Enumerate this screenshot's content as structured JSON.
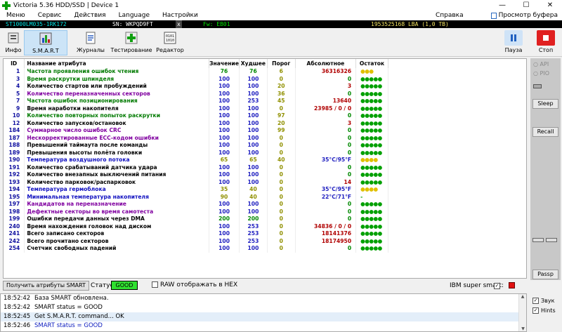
{
  "window": {
    "title": "Victoria 5.36 HDD/SSD | Device 1"
  },
  "menu": {
    "items": [
      "Меню",
      "Сервис",
      "Действия",
      "Language",
      "Настройки"
    ],
    "help": "Справка",
    "clipboard": "Просмотр буфера"
  },
  "info": {
    "model": "ST1000LM035-1RK172",
    "sn": "SN: WKPQD9FT",
    "close": "x",
    "fw": "Fw: EB01",
    "lba": "1953525168 LBA (1,0 TB)"
  },
  "toolbar": {
    "info": "Инфо",
    "smart": "S.M.A.R.T",
    "logs": "Журналы",
    "tests": "Тестирование",
    "editor": "Редактор",
    "pause": "Пауза",
    "stop": "Стоп"
  },
  "table": {
    "headers": [
      "ID",
      "Название атрибута",
      "Значение",
      "Худшее",
      "Порог",
      "Абсолютное",
      "Остаток"
    ],
    "rows": [
      {
        "id": "1",
        "name": "Частота проявления ошибок чтения",
        "val": "76",
        "worst": "76",
        "thr": "6",
        "abs": "36316326",
        "rest": "●●●",
        "nc": "c-green",
        "vc": "v-green",
        "ac": "v-red",
        "rc": "#e0c000"
      },
      {
        "id": "3",
        "name": "Время раскрутки шпинделя",
        "val": "100",
        "worst": "100",
        "thr": "0",
        "abs": "0",
        "rest": "●●●●●",
        "nc": "c-green",
        "vc": "v-blue",
        "ac": "v-green",
        "rc": "#00a000"
      },
      {
        "id": "4",
        "name": "Количество стартов или пробуждений",
        "val": "100",
        "worst": "100",
        "thr": "20",
        "abs": "3",
        "rest": "●●●●●",
        "nc": "c-black",
        "vc": "v-blue",
        "ac": "v-red",
        "rc": "#00a000"
      },
      {
        "id": "5",
        "name": "Количество переназначенных секторов",
        "val": "100",
        "worst": "100",
        "thr": "36",
        "abs": "0",
        "rest": "●●●●●",
        "nc": "c-purple",
        "vc": "v-blue",
        "ac": "v-green",
        "rc": "#00a000"
      },
      {
        "id": "7",
        "name": "Частота ошибок позиционирования",
        "val": "100",
        "worst": "253",
        "thr": "45",
        "abs": "13640",
        "rest": "●●●●●",
        "nc": "c-green",
        "vc": "v-blue",
        "ac": "v-red",
        "rc": "#00a000"
      },
      {
        "id": "9",
        "name": "Время наработки накопителя",
        "val": "100",
        "worst": "100",
        "thr": "0",
        "abs": "23985 / 0 / 0",
        "rest": "●●●●●",
        "nc": "c-black",
        "vc": "v-blue",
        "ac": "v-red",
        "rc": "#00a000"
      },
      {
        "id": "10",
        "name": "Количество повторных попыток раскрутки",
        "val": "100",
        "worst": "100",
        "thr": "97",
        "abs": "0",
        "rest": "●●●●●",
        "nc": "c-green",
        "vc": "v-blue",
        "ac": "v-green",
        "rc": "#00a000"
      },
      {
        "id": "12",
        "name": "Количество запусков/остановок",
        "val": "100",
        "worst": "100",
        "thr": "20",
        "abs": "3",
        "rest": "●●●●●",
        "nc": "c-black",
        "vc": "v-blue",
        "ac": "v-red",
        "rc": "#00a000"
      },
      {
        "id": "184",
        "name": "Суммарное число ошибок CRC",
        "val": "100",
        "worst": "100",
        "thr": "99",
        "abs": "0",
        "rest": "●●●●●",
        "nc": "c-purple",
        "vc": "v-blue",
        "ac": "v-green",
        "rc": "#00a000"
      },
      {
        "id": "187",
        "name": "Нескорректированные ECC-кодом ошибки",
        "val": "100",
        "worst": "100",
        "thr": "0",
        "abs": "0",
        "rest": "●●●●●",
        "nc": "c-purple",
        "vc": "v-blue",
        "ac": "v-green",
        "rc": "#00a000"
      },
      {
        "id": "188",
        "name": "Превышений таймаута после команды",
        "val": "100",
        "worst": "100",
        "thr": "0",
        "abs": "0",
        "rest": "●●●●●",
        "nc": "c-black",
        "vc": "v-blue",
        "ac": "v-green",
        "rc": "#00a000"
      },
      {
        "id": "189",
        "name": "Превышения высоты полёта головки",
        "val": "100",
        "worst": "100",
        "thr": "0",
        "abs": "0",
        "rest": "●●●●●",
        "nc": "c-black",
        "vc": "v-blue",
        "ac": "v-green",
        "rc": "#00a000"
      },
      {
        "id": "190",
        "name": "Температура воздушного потока",
        "val": "65",
        "worst": "65",
        "thr": "40",
        "abs": "35°C/95°F",
        "rest": "●●●●",
        "nc": "c-blue",
        "vc": "v-olive",
        "ac": "v-blue",
        "rc": "#e0c000"
      },
      {
        "id": "191",
        "name": "Количество срабатываний датчика удара",
        "val": "100",
        "worst": "100",
        "thr": "0",
        "abs": "0",
        "rest": "●●●●●",
        "nc": "c-black",
        "vc": "v-blue",
        "ac": "v-green",
        "rc": "#00a000"
      },
      {
        "id": "192",
        "name": "Количество внезапных выключений питания",
        "val": "100",
        "worst": "100",
        "thr": "0",
        "abs": "0",
        "rest": "●●●●●",
        "nc": "c-black",
        "vc": "v-blue",
        "ac": "v-green",
        "rc": "#00a000"
      },
      {
        "id": "193",
        "name": "Количество парковок/распарковок",
        "val": "100",
        "worst": "100",
        "thr": "0",
        "abs": "14",
        "rest": "●●●●●",
        "nc": "c-black",
        "vc": "v-blue",
        "ac": "v-red",
        "rc": "#00a000"
      },
      {
        "id": "194",
        "name": "Температура гермоблока",
        "val": "35",
        "worst": "40",
        "thr": "0",
        "abs": "35°C/95°F",
        "rest": "●●●●",
        "nc": "c-blue",
        "vc": "v-olive",
        "ac": "v-blue",
        "rc": "#e0c000"
      },
      {
        "id": "195",
        "name": "Минимальная температура накопителя",
        "val": "90",
        "worst": "40",
        "thr": "0",
        "abs": "22°C/71°F",
        "rest": "-",
        "nc": "c-blue",
        "vc": "v-olive",
        "ac": "v-blue",
        "rc": "#00a000"
      },
      {
        "id": "197",
        "name": "Кандидатов на переназначение",
        "val": "100",
        "worst": "100",
        "thr": "0",
        "abs": "0",
        "rest": "●●●●●",
        "nc": "c-purple",
        "vc": "v-blue",
        "ac": "v-green",
        "rc": "#00a000"
      },
      {
        "id": "198",
        "name": "Дефектные секторы во время самотеста",
        "val": "100",
        "worst": "100",
        "thr": "0",
        "abs": "0",
        "rest": "●●●●●",
        "nc": "c-purple",
        "vc": "v-blue",
        "ac": "v-green",
        "rc": "#00a000"
      },
      {
        "id": "199",
        "name": "Ошибки передачи данных через DMA",
        "val": "200",
        "worst": "200",
        "thr": "0",
        "abs": "0",
        "rest": "●●●●●",
        "nc": "c-black",
        "vc": "v-green",
        "ac": "v-green",
        "rc": "#00a000"
      },
      {
        "id": "240",
        "name": "Время нахождения головок над диском",
        "val": "100",
        "worst": "253",
        "thr": "0",
        "abs": "34836 / 0 / 0",
        "rest": "●●●●●",
        "nc": "c-black",
        "vc": "v-blue",
        "ac": "v-red",
        "rc": "#00a000"
      },
      {
        "id": "241",
        "name": "Всего записано секторов",
        "val": "100",
        "worst": "253",
        "thr": "0",
        "abs": "18141376",
        "rest": "●●●●●",
        "nc": "c-black",
        "vc": "v-blue",
        "ac": "v-red",
        "rc": "#00a000"
      },
      {
        "id": "242",
        "name": "Всего прочитано секторов",
        "val": "100",
        "worst": "253",
        "thr": "0",
        "abs": "18174950",
        "rest": "●●●●●",
        "nc": "c-black",
        "vc": "v-blue",
        "ac": "v-red",
        "rc": "#00a000"
      },
      {
        "id": "254",
        "name": "Счетчик свободных падений",
        "val": "100",
        "worst": "100",
        "thr": "0",
        "abs": "0",
        "rest": "●●●●●",
        "nc": "c-black",
        "vc": "v-blue",
        "ac": "v-green",
        "rc": "#00a000"
      }
    ]
  },
  "side": {
    "api": "API",
    "pio": "PIO",
    "sleep": "Sleep",
    "recall": "Recall",
    "passp": "Passp"
  },
  "status": {
    "get_button": "Получить атрибуты SMART",
    "label": "Статус:",
    "value": "GOOD",
    "raw_hex": "RAW отображать в HEX",
    "ibm": "IBM super smart:"
  },
  "log": [
    {
      "time": "18:52:42",
      "msg": "База SMART обновлена.",
      "color": "#000"
    },
    {
      "time": "18:52:42",
      "msg": "SMART status = GOOD",
      "color": "#000"
    },
    {
      "time": "18:52:45",
      "msg": "Get S.M.A.R.T. command... OK",
      "color": "#000"
    },
    {
      "time": "18:52:46",
      "msg": "SMART status = GOOD",
      "color": "#1020c0"
    }
  ],
  "checks": {
    "sound": "Звук",
    "hints": "Hints"
  }
}
